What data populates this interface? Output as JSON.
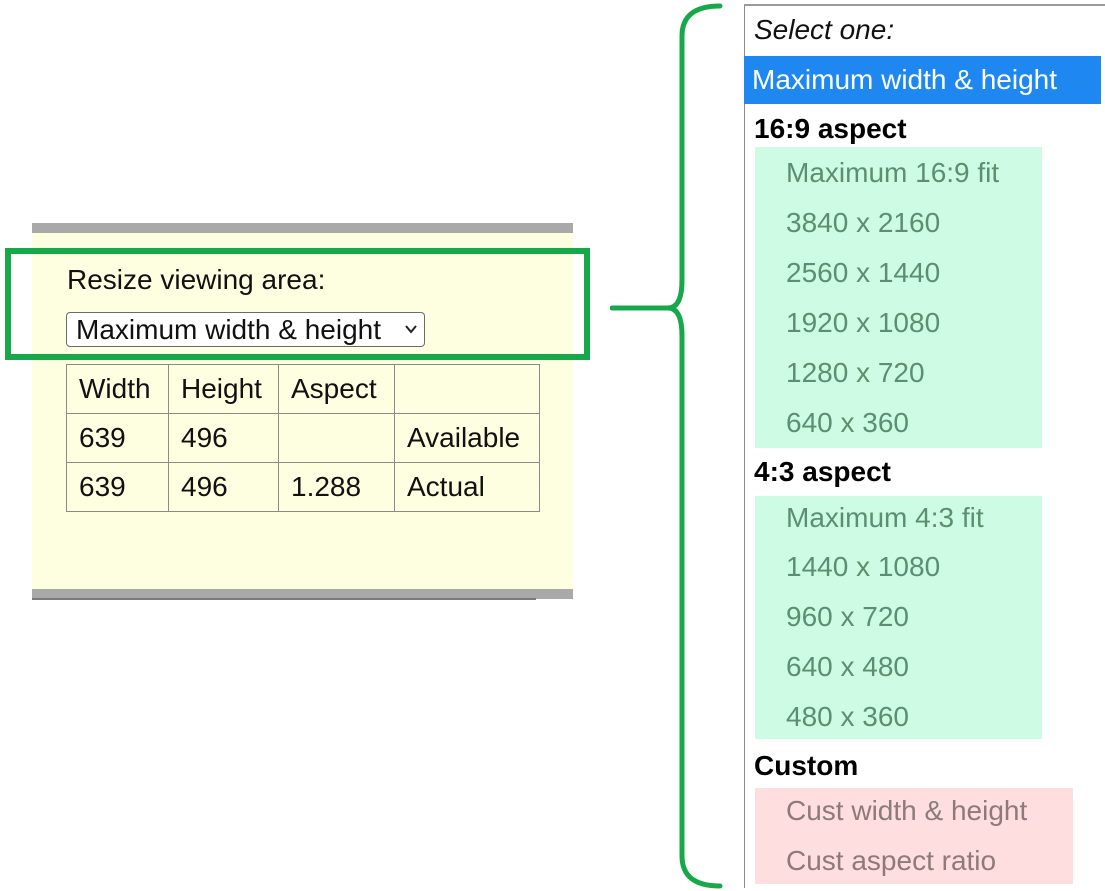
{
  "panel": {
    "resize_label": "Resize viewing area:",
    "select_value": "Maximum width & height"
  },
  "table": {
    "rows": [
      [
        "Width",
        "Height",
        "Aspect",
        ""
      ],
      [
        "639",
        "496",
        "",
        "Available"
      ],
      [
        "639",
        "496",
        "1.288",
        "Actual"
      ]
    ]
  },
  "dropdown": {
    "prompt": "Select one:",
    "selected": "Maximum width & height",
    "groups": [
      {
        "label": "16:9 aspect",
        "options": [
          "Maximum 16:9 fit",
          "3840 x 2160",
          "2560 x 1440",
          "1920 x 1080",
          "1280 x 720",
          "640 x 360"
        ]
      },
      {
        "label": "4:3 aspect",
        "options": [
          "Maximum 4:3 fit",
          "1440 x 1080",
          "960 x 720",
          "640 x 480",
          "480 x 360"
        ]
      },
      {
        "label": "Custom",
        "options": [
          "Cust width & height",
          "Cust aspect ratio"
        ]
      }
    ]
  },
  "colors": {
    "highlight": "#17a84a",
    "panel_bg": "#fefee0",
    "selected_bg": "#1e88f0",
    "green_option_bg": "#cdfbe3",
    "red_option_bg": "#fedede"
  },
  "icons": {
    "select_chevron": "chevron-down-icon",
    "brace": "curly-brace-icon"
  }
}
